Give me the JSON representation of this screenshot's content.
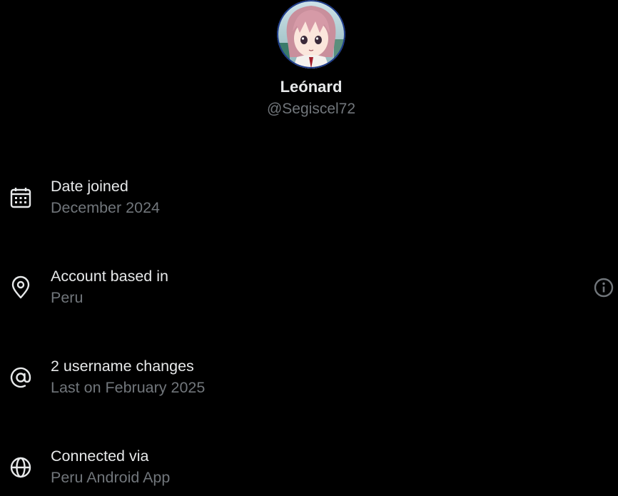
{
  "profile": {
    "display_name": "Leónard",
    "handle": "@Segiscel72"
  },
  "rows": [
    {
      "icon": "calendar-icon",
      "title": "Date joined",
      "subtitle": "December 2024"
    },
    {
      "icon": "location-pin-icon",
      "title": "Account based in",
      "subtitle": "Peru",
      "action_icon": "info-icon"
    },
    {
      "icon": "at-sign-icon",
      "title": "2 username changes",
      "subtitle": "Last on February 2025"
    },
    {
      "icon": "globe-icon",
      "title": "Connected via",
      "subtitle": "Peru Android App"
    }
  ],
  "colors": {
    "background": "#000000",
    "primary_text": "#e7e9ea",
    "secondary_text": "#71767b",
    "info_icon": "#71767b"
  }
}
